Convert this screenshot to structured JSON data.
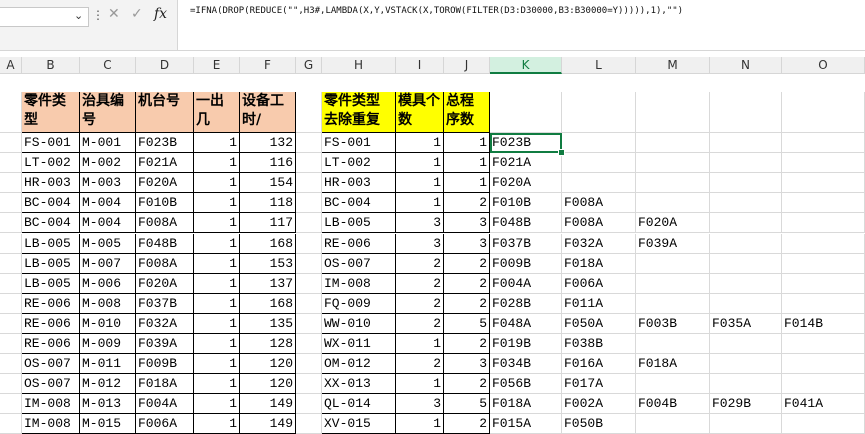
{
  "formula_bar": {
    "formula": "=IFNA(DROP(REDUCE(\"\",H3#,LAMBDA(X,Y,VSTACK(X,TOROW(FILTER(D3:D30000,B3:B30000=Y))))),1),\"\")",
    "cancel_glyph": "✕",
    "enter_glyph": "✓",
    "fx_glyph": "fx",
    "chevron_glyph": "⌄",
    "more_glyph": "⋮"
  },
  "columns": [
    "A",
    "B",
    "C",
    "D",
    "E",
    "F",
    "G",
    "H",
    "I",
    "J",
    "K",
    "L",
    "M",
    "N",
    "O"
  ],
  "selected_column": "K",
  "left_table": {
    "headers": [
      "零件类型",
      "治具编号",
      "机台号",
      "一出几",
      "设备工时/"
    ],
    "rows": [
      [
        "FS-001",
        "M-001",
        "F023B",
        "1",
        "132"
      ],
      [
        "LT-002",
        "M-002",
        "F021A",
        "1",
        "116"
      ],
      [
        "HR-003",
        "M-003",
        "F020A",
        "1",
        "154"
      ],
      [
        "BC-004",
        "M-004",
        "F010B",
        "1",
        "118"
      ],
      [
        "BC-004",
        "M-004",
        "F008A",
        "1",
        "117"
      ],
      [
        "LB-005",
        "M-005",
        "F048B",
        "1",
        "168"
      ],
      [
        "LB-005",
        "M-007",
        "F008A",
        "1",
        "153"
      ],
      [
        "LB-005",
        "M-006",
        "F020A",
        "1",
        "137"
      ],
      [
        "RE-006",
        "M-008",
        "F037B",
        "1",
        "168"
      ],
      [
        "RE-006",
        "M-010",
        "F032A",
        "1",
        "135"
      ],
      [
        "RE-006",
        "M-009",
        "F039A",
        "1",
        "128"
      ],
      [
        "OS-007",
        "M-011",
        "F009B",
        "1",
        "120"
      ],
      [
        "OS-007",
        "M-012",
        "F018A",
        "1",
        "120"
      ],
      [
        "IM-008",
        "M-013",
        "F004A",
        "1",
        "149"
      ],
      [
        "IM-008",
        "M-015",
        "F006A",
        "1",
        "149"
      ]
    ]
  },
  "right_table": {
    "headers": [
      "零件类型去除重复",
      "模具个数",
      "总程序数"
    ],
    "rows": [
      [
        "FS-001",
        "1",
        "1",
        [
          "F023B"
        ]
      ],
      [
        "LT-002",
        "1",
        "1",
        [
          "F021A"
        ]
      ],
      [
        "HR-003",
        "1",
        "1",
        [
          "F020A"
        ]
      ],
      [
        "BC-004",
        "1",
        "2",
        [
          "F010B",
          "F008A"
        ]
      ],
      [
        "LB-005",
        "3",
        "3",
        [
          "F048B",
          "F008A",
          "F020A"
        ]
      ],
      [
        "RE-006",
        "3",
        "3",
        [
          "F037B",
          "F032A",
          "F039A"
        ]
      ],
      [
        "OS-007",
        "2",
        "2",
        [
          "F009B",
          "F018A"
        ]
      ],
      [
        "IM-008",
        "2",
        "2",
        [
          "F004A",
          "F006A"
        ]
      ],
      [
        "FQ-009",
        "2",
        "2",
        [
          "F028B",
          "F011A"
        ]
      ],
      [
        "WW-010",
        "2",
        "5",
        [
          "F048A",
          "F050A",
          "F003B",
          "F035A",
          "F014B"
        ]
      ],
      [
        "WX-011",
        "1",
        "2",
        [
          "F019B",
          "F038B"
        ]
      ],
      [
        "OM-012",
        "2",
        "3",
        [
          "F034B",
          "F016A",
          "F018A"
        ]
      ],
      [
        "XX-013",
        "1",
        "2",
        [
          "F056B",
          "F017A"
        ]
      ],
      [
        "QL-014",
        "3",
        "5",
        [
          "F018A",
          "F002A",
          "F004B",
          "F029B",
          "F041A"
        ]
      ],
      [
        "XV-015",
        "1",
        "2",
        [
          "F015A",
          "F050B"
        ]
      ]
    ]
  }
}
